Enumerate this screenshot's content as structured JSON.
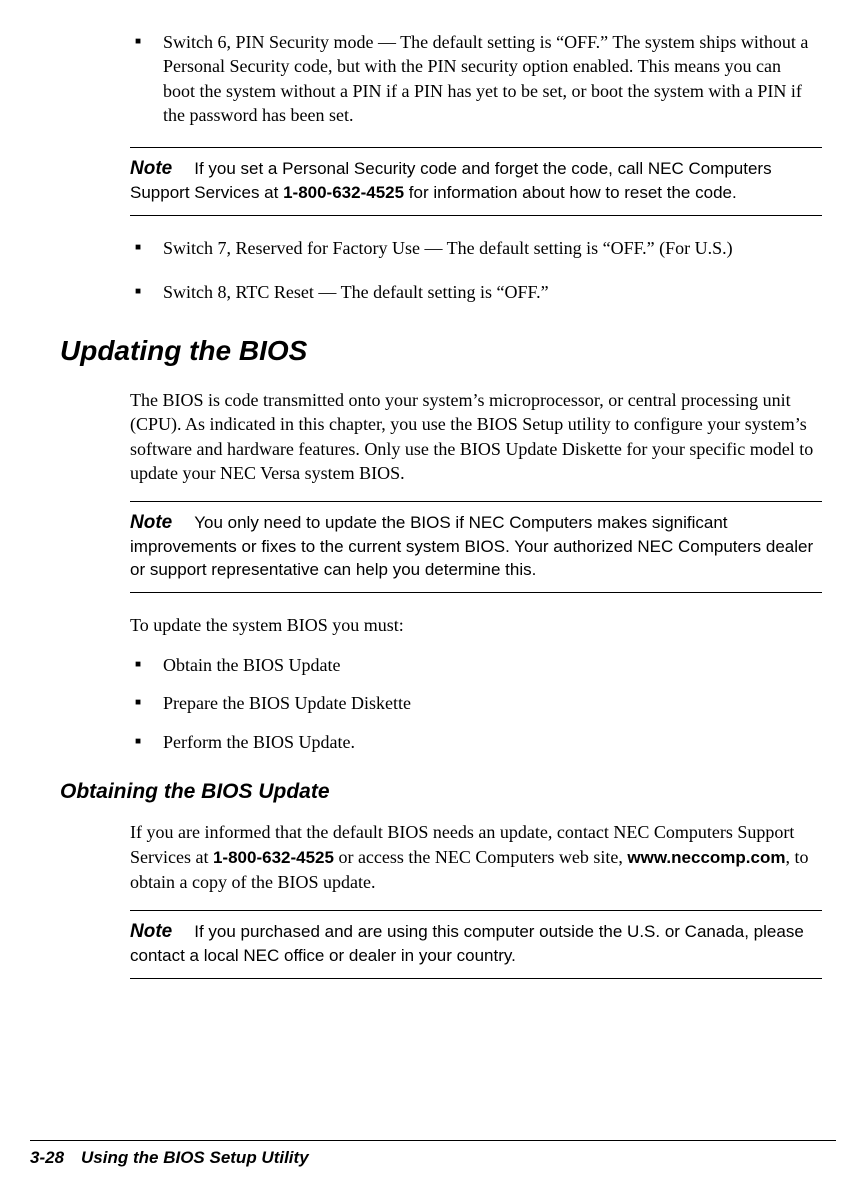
{
  "bullets_top": [
    "Switch 6, PIN Security mode — The default setting is “OFF.” The system ships without a Personal Security code, but with the PIN security option enabled. This means you can boot the system without a PIN if a PIN has yet to be set, or boot the system with a PIN if the password has been set."
  ],
  "note1": {
    "label": "Note",
    "text_before_phone": "If you set a Personal Security code and forget the code, call NEC Computers Support Services at ",
    "phone": "1-800-632-4525",
    "text_after_phone": " for information about how to reset the code."
  },
  "bullets_mid": [
    "Switch 7, Reserved for Factory Use — The default setting  is “OFF.” (For U.S.)",
    "Switch 8, RTC Reset — The default setting is “OFF.”"
  ],
  "heading_updating": "Updating the BIOS",
  "para_updating": "The BIOS is code transmitted onto your system’s microprocessor, or central processing unit (CPU). As indicated in this chapter, you use the BIOS Setup utility to configure your system’s software and hardware features. Only use the BIOS Update Diskette for your specific model to update your NEC Versa system BIOS.",
  "note2": {
    "label": "Note",
    "text": "You only need to update the BIOS if NEC Computers makes significant improvements or fixes to the current system BIOS. Your authorized NEC Computers dealer or support representative can help you determine this."
  },
  "para_tolist": "To update the system BIOS you must:",
  "steps": [
    "Obtain the BIOS Update",
    "Prepare the BIOS Update Diskette",
    "Perform the BIOS Update."
  ],
  "heading_obtaining": "Obtaining the BIOS Update",
  "para_obtaining_before_phone": "If you are informed that the default BIOS needs an update, contact NEC Computers Support Services at ",
  "para_obtaining_phone": "1-800-632-4525",
  "para_obtaining_mid": " or access the NEC Computers web site, ",
  "para_obtaining_url": "www.neccomp.com",
  "para_obtaining_after": ", to obtain a copy of the BIOS update.",
  "note3": {
    "label": "Note",
    "text": "If you purchased and are using this computer outside the U.S. or Canada, please contact a local NEC office or dealer in your country."
  },
  "footer": "3-28 Using the BIOS Setup Utility"
}
